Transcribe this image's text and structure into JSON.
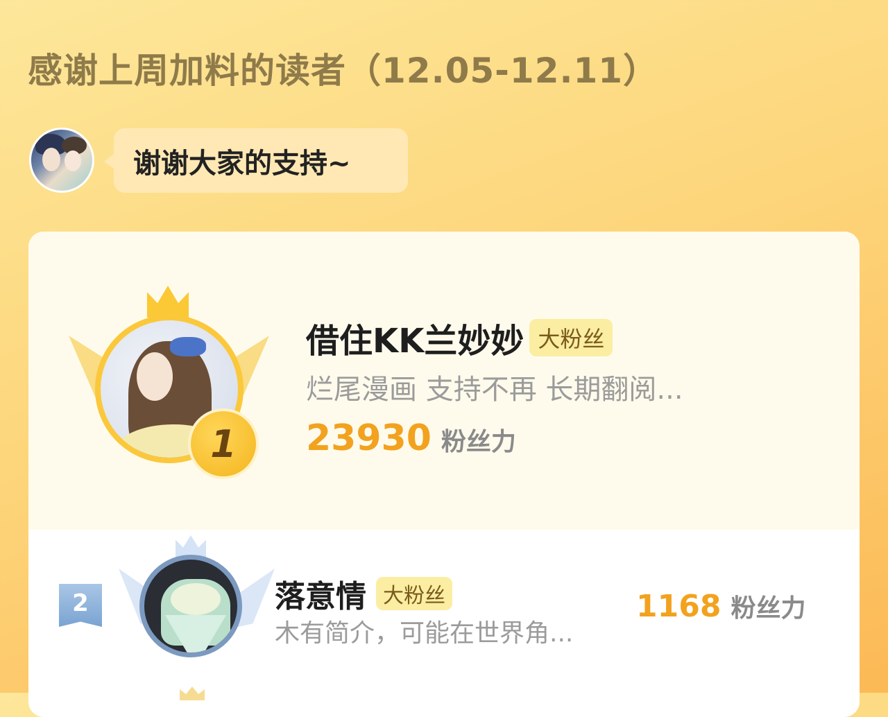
{
  "header": {
    "title": "感谢上周加料的读者（12.05-12.11）"
  },
  "author_message": {
    "text": "谢谢大家的支持~"
  },
  "colors": {
    "accent": "#f2a21e",
    "gold": "#fbc83c",
    "silver": "#7c9ac0",
    "badge_bg": "#fbeda2"
  },
  "ranking": [
    {
      "rank": "1",
      "name": "借住KK兰妙妙",
      "badge": "大粉丝",
      "bio": "烂尾漫画 支持不再 长期翻阅...",
      "score": "23930",
      "score_unit": "粉丝力"
    },
    {
      "rank": "2",
      "name": "落意情",
      "badge": "大粉丝",
      "bio": "木有简介，可能在世界角...",
      "score": "1168",
      "score_unit": "粉丝力"
    }
  ]
}
